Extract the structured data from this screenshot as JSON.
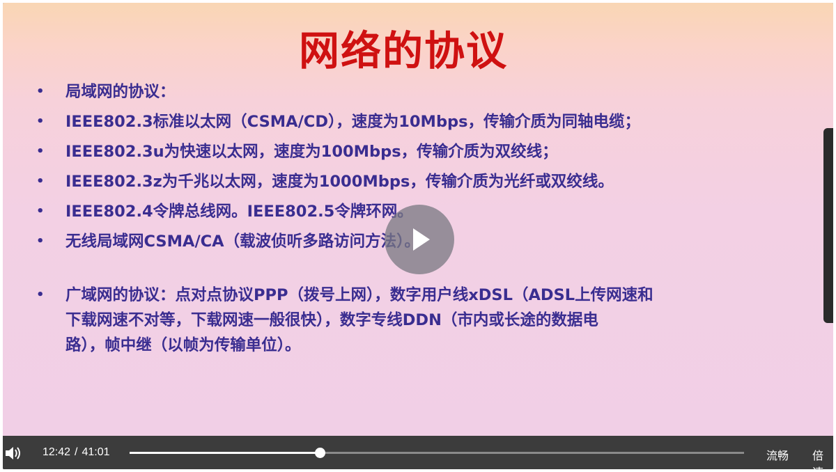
{
  "slide": {
    "title": "网络的协议",
    "bullet_symbol": "•",
    "bullets": [
      "局域网的协议：",
      "IEEE802.3标准以太网（CSMA/CD），速度为10Mbps，传输介质为同轴电缆；",
      "IEEE802.3u为快速以太网，速度为100Mbps，传输介质为双绞线；",
      "IEEE802.3z为千兆以太网，速度为1000Mbps，传输介质为光纤或双绞线。",
      "IEEE802.4令牌总线网。IEEE802.5令牌环网。",
      "无线局域网CSMA/CA（载波侦听多路访问方法）。"
    ],
    "wan_bullet_lines": [
      "广域网的协议：点对点协议PPP（拨号上网），数字用户线xDSL（ADSL上传网速和",
      "下载网速不对等，下载网速一般很快），数字专线DDN（市内或长途的数据电",
      "路），帧中继（以帧为传输单位）。"
    ]
  },
  "player": {
    "play_icon": "play-icon",
    "volume_icon": "speaker-icon",
    "current_time": "12:42",
    "separator": "/",
    "duration": "41:01",
    "progress_fraction": 0.31,
    "quality_label": "流畅",
    "speed_label": "倍速"
  },
  "colors": {
    "title": "#cf1111",
    "text": "#3a2d90",
    "control_bar": "#3c3c3c"
  }
}
